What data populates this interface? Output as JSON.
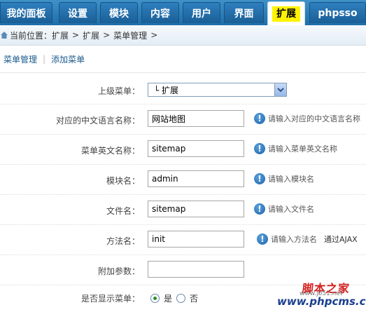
{
  "nav": {
    "tabs": [
      {
        "label": "我的面板"
      },
      {
        "label": "设置"
      },
      {
        "label": "模块"
      },
      {
        "label": "内容"
      },
      {
        "label": "用户"
      },
      {
        "label": "界面"
      },
      {
        "label": "扩展",
        "active": true
      },
      {
        "label": "phpsso"
      }
    ]
  },
  "breadcrumb": {
    "prefix": "当前位置：",
    "items": [
      "扩展",
      "扩展",
      "菜单管理"
    ],
    "separator": ">"
  },
  "subnav": {
    "manage_label": "菜单管理",
    "add_label": "添加菜单"
  },
  "form": {
    "parent_menu": {
      "label": "上级菜单：",
      "value": "└ 扩展"
    },
    "cn_name": {
      "label": "对应的中文语言名称：",
      "value": "网站地图",
      "hint": "请输入对应的中文语言名称"
    },
    "en_name": {
      "label": "菜单英文名称：",
      "value": "sitemap",
      "hint": "请输入菜单英文名称"
    },
    "module": {
      "label": "模块名：",
      "value": "admin",
      "hint": "请输入模块名"
    },
    "file": {
      "label": "文件名：",
      "value": "sitemap",
      "hint": "请输入文件名"
    },
    "method": {
      "label": "方法名：",
      "value": "init",
      "hint": "请输入方法名",
      "extra": "通过AJAX"
    },
    "params": {
      "label": "附加参数：",
      "value": ""
    },
    "display": {
      "label": "是否显示菜单：",
      "yes": "是",
      "no": "否",
      "selected": "yes"
    }
  },
  "watermark": {
    "line1": "脚本之家",
    "line2": "www.phpcms.cn",
    "line3": "www.jb51.net"
  }
}
